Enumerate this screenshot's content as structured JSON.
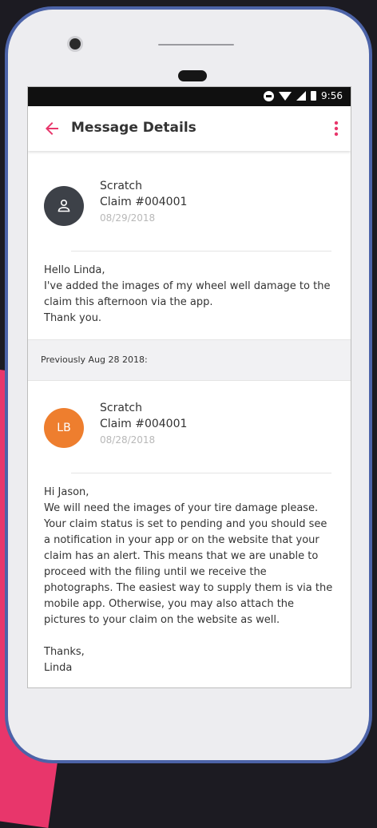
{
  "status_bar": {
    "time": "9:56"
  },
  "app_bar": {
    "title": "Message Details"
  },
  "messages": [
    {
      "avatar_initials": "",
      "avatar_color": "#3d4148",
      "subject": "Scratch",
      "claim": "Claim #004001",
      "date": "08/29/2018",
      "body_lines": [
        "Hello Linda,",
        "I've added the images of my wheel well damage to the claim this afternoon via the app.",
        "Thank you."
      ]
    },
    {
      "avatar_initials": "LB",
      "avatar_color": "#ee7e2e",
      "subject": "Scratch",
      "claim": "Claim #004001",
      "date": "08/28/2018",
      "body_lines": [
        "Hi Jason,",
        "We will need the images of your tire damage please. Your claim status is set to pending and you should see a notification in your app or on the website that your claim has an alert. This means that we are unable to proceed with the filing until we receive the photographs. The easiest way to supply them is via the mobile app. Otherwise, you may also attach the pictures to your claim on the website as well.",
        "",
        "Thanks,",
        "Linda"
      ]
    }
  ],
  "previous_label": "Previously Aug 28 2018:",
  "colors": {
    "accent": "#e8366b",
    "phone_frame": "#4c63a8"
  }
}
